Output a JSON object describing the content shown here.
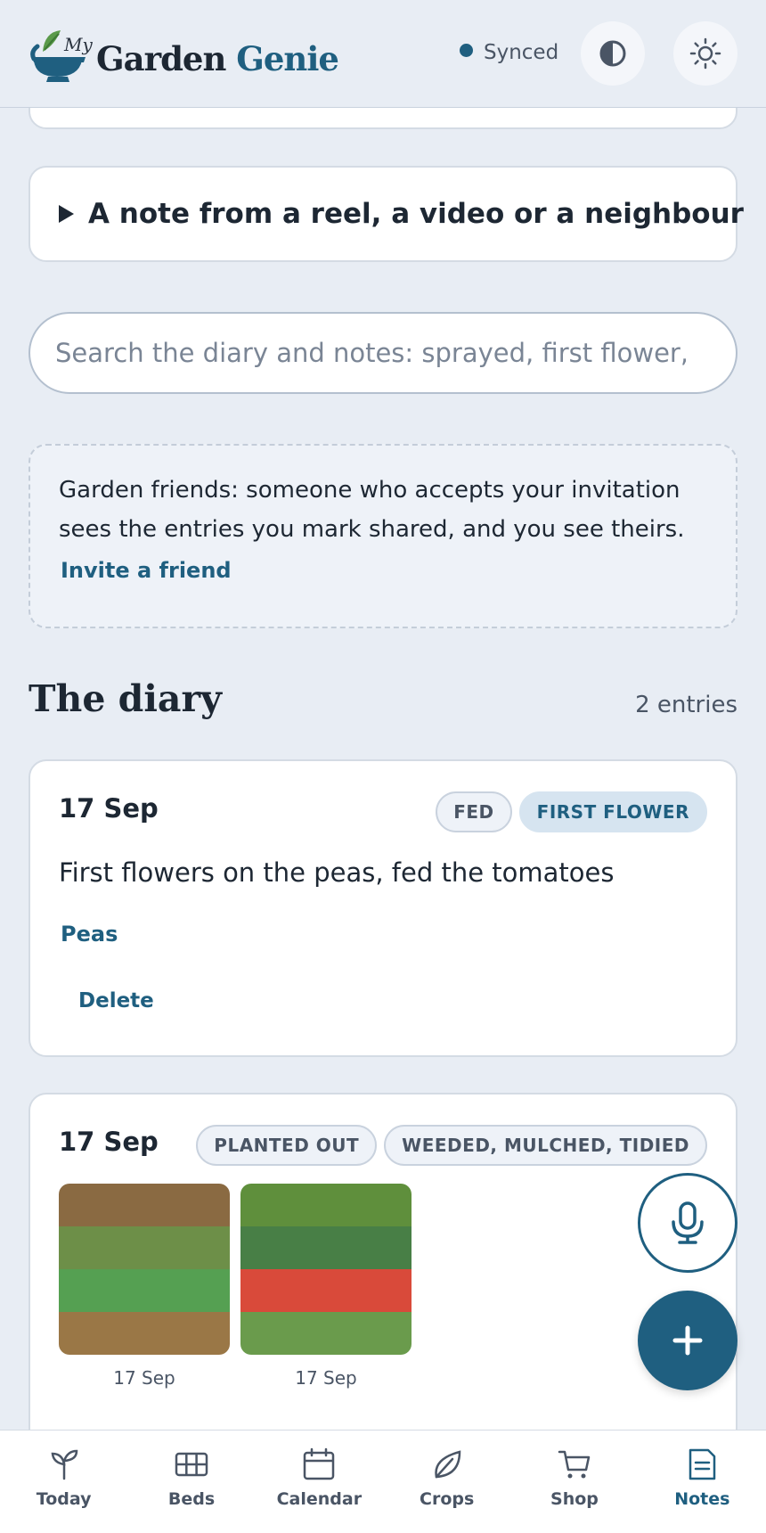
{
  "app": {
    "logo_my": "My",
    "logo_word1": "Garden",
    "logo_word2": "Genie"
  },
  "header": {
    "sync_status": "Synced",
    "contrast_icon": "contrast-icon",
    "theme_icon": "sun-icon"
  },
  "note_disclosure": {
    "title": "A note from a reel, a video or a neighbour"
  },
  "search": {
    "placeholder": "Search the diary and notes: sprayed, first flower, cold"
  },
  "friends": {
    "text": "Garden friends: someone who accepts your invitation sees the entries you mark shared, and you see theirs.",
    "invite_label": "Invite a friend"
  },
  "diary": {
    "title": "The diary",
    "count": "2 entries",
    "entries": [
      {
        "date": "17 Sep",
        "tags": [
          "FED",
          "FIRST FLOWER"
        ],
        "text": "First flowers on the peas, fed the tomatoes",
        "crop": "Peas",
        "delete_label": "Delete"
      },
      {
        "date": "17 Sep",
        "tags": [
          "PLANTED OUT",
          "WEEDED, MULCHED, TIDIED"
        ],
        "photos": [
          {
            "caption": "17 Sep",
            "colors": [
              "#8a6a42",
              "#6d8f48",
              "#55a052",
              "#9a7746"
            ]
          },
          {
            "caption": "17 Sep",
            "colors": [
              "#5f8f3c",
              "#487f46",
              "#d94a3a",
              "#6a9b4c"
            ]
          }
        ]
      }
    ]
  },
  "fab": {
    "mic_icon": "microphone-icon",
    "add_icon": "plus-icon"
  },
  "nav": {
    "items": [
      {
        "label": "Today",
        "icon": "sprout-icon"
      },
      {
        "label": "Beds",
        "icon": "grid-icon"
      },
      {
        "label": "Calendar",
        "icon": "calendar-icon"
      },
      {
        "label": "Crops",
        "icon": "leaf-icon"
      },
      {
        "label": "Shop",
        "icon": "cart-icon"
      },
      {
        "label": "Notes",
        "icon": "notes-icon",
        "active": true
      }
    ]
  },
  "colors": {
    "accent": "#1f5f80",
    "background": "#e8edf4",
    "text": "#1d2733"
  }
}
